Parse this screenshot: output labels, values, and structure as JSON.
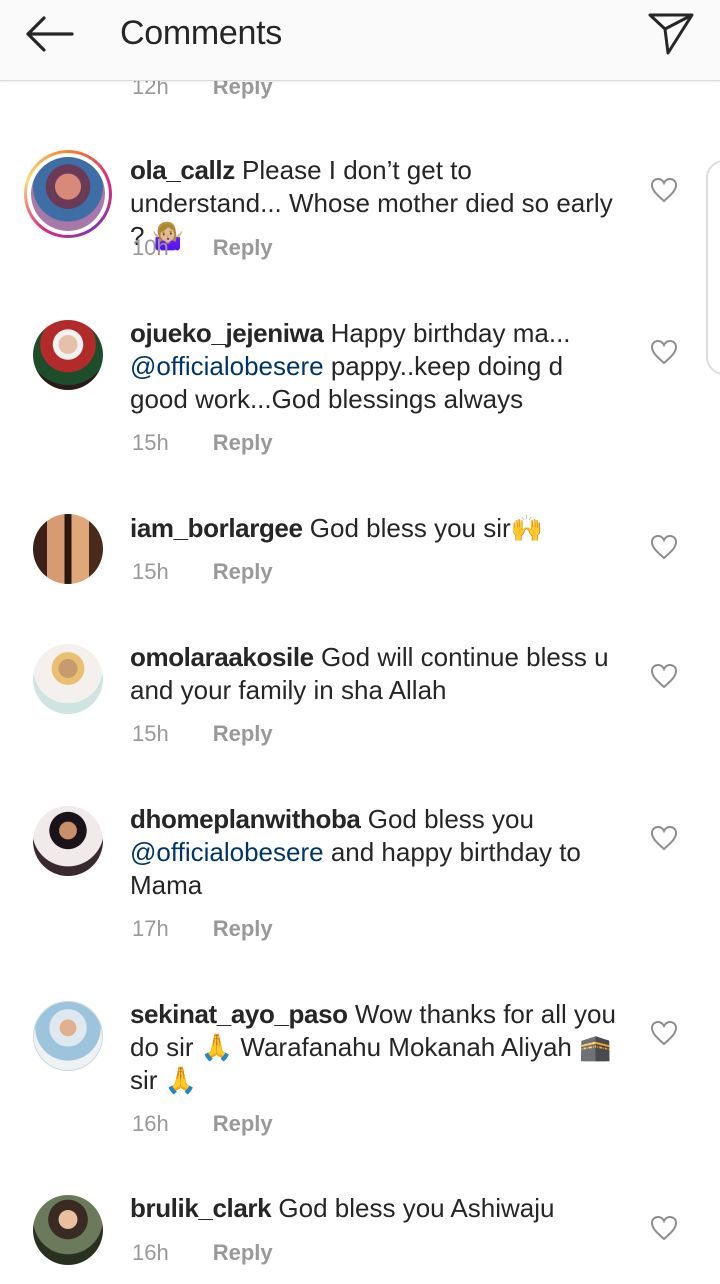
{
  "header": {
    "title": "Comments"
  },
  "top_partial": {
    "time": "12h",
    "reply": "Reply"
  },
  "comments": [
    {
      "username": "ola_callz",
      "text": "Please I don’t get to understand... Whose mother died so early ? 🤷🏼‍♀️",
      "time": "10h",
      "reply": "Reply"
    },
    {
      "username": "ojueko_jejeniwa",
      "text_before": "Happy birthday ma...",
      "mention": "@officialobesere",
      "text_after": "pappy..keep doing d good work...God blessings always",
      "time": "15h",
      "reply": "Reply"
    },
    {
      "username": "iam_borlargee",
      "text": "God bless you sir🙌",
      "time": "15h",
      "reply": "Reply"
    },
    {
      "username": "omolaraakosile",
      "text": "God will continue bless u and your family in sha Allah",
      "time": "15h",
      "reply": "Reply"
    },
    {
      "username": "dhomeplanwithoba",
      "text_before": "God bless you",
      "mention": "@officialobesere",
      "text_after": " and happy birthday to Mama",
      "time": "17h",
      "reply": "Reply"
    },
    {
      "username": "sekinat_ayo_paso",
      "text": "Wow thanks for all you do sir 🙏 Warafanahu Mokanah Aliyah 🕋 sir 🙏",
      "time": "16h",
      "reply": "Reply"
    },
    {
      "username": "brulik_clark",
      "text": "God bless you Ashiwaju",
      "time": "16h",
      "reply": "Reply"
    }
  ],
  "colors": {
    "mention": "#003569",
    "meta": "#999999",
    "text": "#262626",
    "header_bg": "#fafafa"
  },
  "icons": {
    "back": "arrow-left-icon",
    "send": "paper-plane-icon",
    "like": "heart-outline-icon"
  }
}
